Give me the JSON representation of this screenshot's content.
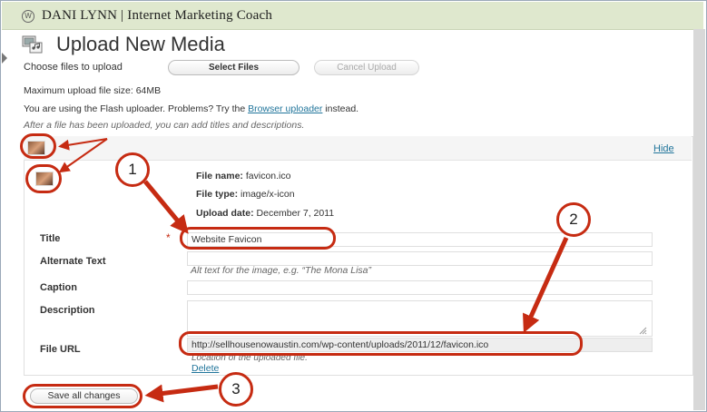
{
  "site": {
    "title": "DANI LYNN | Internet Marketing Coach"
  },
  "page": {
    "title": "Upload New Media"
  },
  "upload": {
    "choose_label": "Choose files to upload",
    "select_button": "Select Files",
    "cancel_button": "Cancel Upload",
    "max_size": "Maximum upload file size: 64MB",
    "flash_notice_before": "You are using the Flash uploader. Problems? Try the ",
    "browser_uploader_link": "Browser uploader",
    "flash_notice_after": " instead.",
    "after_upload_hint": "After a file has been uploaded, you can add titles and descriptions."
  },
  "item": {
    "hide_link": "Hide",
    "file_name_label": "File name:",
    "file_name": "favicon.ico",
    "file_type_label": "File type:",
    "file_type": "image/x-icon",
    "upload_date_label": "Upload date:",
    "upload_date": "December 7, 2011"
  },
  "form": {
    "title_label": "Title",
    "required_mark": "*",
    "title_value": "Website Favicon",
    "alt_label": "Alternate Text",
    "alt_value": "",
    "alt_hint": "Alt text for the image, e.g. “The Mona Lisa”",
    "caption_label": "Caption",
    "caption_value": "",
    "description_label": "Description",
    "description_value": "",
    "file_url_label": "File URL",
    "file_url": "http://sellhousenowaustin.com/wp-content/uploads/2011/12/favicon.ico",
    "file_url_hint": "Location of the uploaded file.",
    "delete_link": "Delete"
  },
  "footer": {
    "save_button": "Save all changes"
  },
  "annotations": {
    "callout_1": "1",
    "callout_2": "2",
    "callout_3": "3"
  },
  "colors": {
    "annotation_red": "#c62b12",
    "header_bar": "#dfe8ce",
    "link_blue": "#21759b"
  }
}
